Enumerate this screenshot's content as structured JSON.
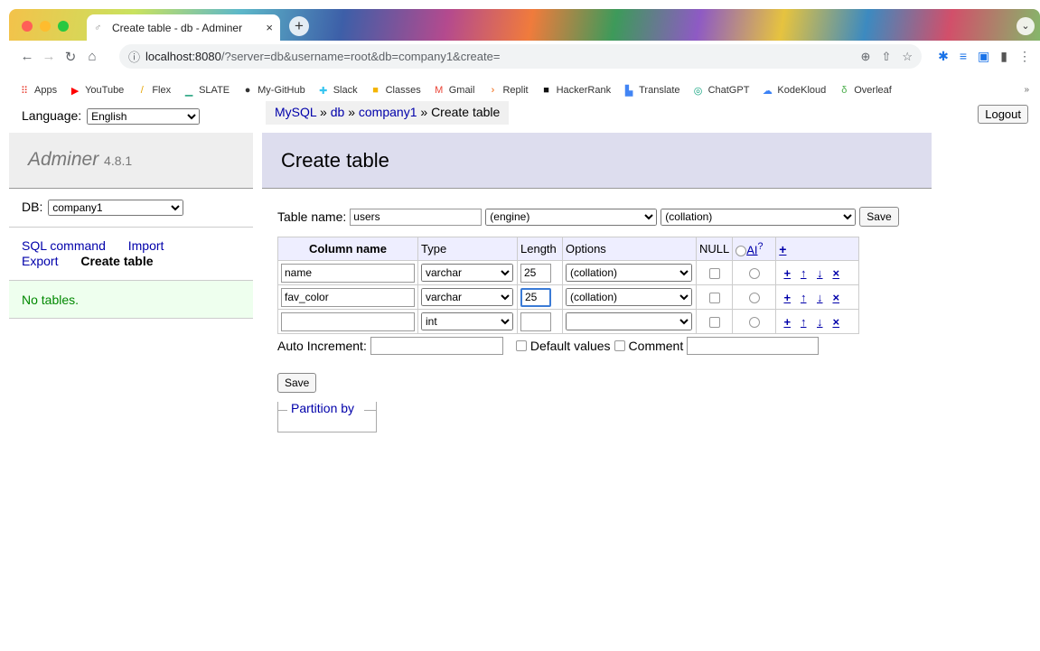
{
  "browser": {
    "tab_title": "Create table - db - Adminer",
    "tab_close": "×",
    "new_tab": "+",
    "url_host": "localhost:8080",
    "url_rest": "/?server=db&username=root&db=company1&create=",
    "bookmarks": [
      "Apps",
      "YouTube",
      "Flex",
      "SLATE",
      "My-GitHub",
      "Slack",
      "Classes",
      "Gmail",
      "Replit",
      "HackerRank",
      "Translate",
      "ChatGPT",
      "KodeKloud",
      "Overleaf"
    ],
    "bookmarks_more": "»"
  },
  "sidebar": {
    "language_label": "Language:",
    "language_value": "English",
    "app_name": "Adminer",
    "app_version": "4.8.1",
    "db_label": "DB:",
    "db_value": "company1",
    "links": {
      "sql_command": "SQL command",
      "import": "Import",
      "export": "Export",
      "create_table": "Create table"
    },
    "no_tables": "No tables."
  },
  "header": {
    "breadcrumb": {
      "mysql": "MySQL",
      "sep1": " » ",
      "db": "db",
      "sep2": " » ",
      "company": "company1",
      "sep3": " » ",
      "current": "Create table"
    },
    "logout": "Logout",
    "title": "Create table"
  },
  "form": {
    "table_name_label": "Table name:",
    "table_name_value": "users",
    "engine": "(engine)",
    "collation": "(collation)",
    "save": "Save",
    "columns_header": {
      "name": "Column name",
      "type": "Type",
      "length": "Length",
      "options": "Options",
      "null": "NULL",
      "ai": "AI",
      "ai_sup": "?",
      "add": "+"
    },
    "rows": [
      {
        "name": "name",
        "type": "varchar",
        "length": "25",
        "options": "(collation)"
      },
      {
        "name": "fav_color",
        "type": "varchar",
        "length": "25",
        "options": "(collation)"
      },
      {
        "name": "",
        "type": "int",
        "length": "",
        "options": ""
      }
    ],
    "row_tools": {
      "add": "+",
      "up": "↑",
      "down": "↓",
      "remove": "×"
    },
    "auto_increment_label": "Auto Increment:",
    "default_values_label": "Default values",
    "comment_label": "Comment",
    "save2": "Save",
    "partition_label": "Partition by"
  }
}
